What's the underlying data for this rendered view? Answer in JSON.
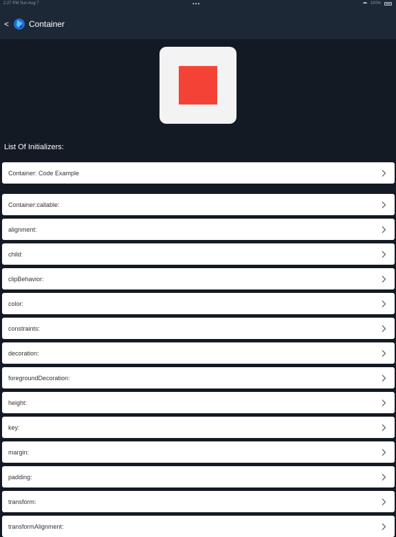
{
  "status_bar": {
    "time": "2:27 PM   Sun Aug 7",
    "dots": "•••",
    "battery": "100%"
  },
  "nav": {
    "back": "<",
    "title": "Container",
    "logo_icon": "flutter-logo-icon"
  },
  "preview": {
    "box_color": "#f3f3f3",
    "square_color": "#f44336"
  },
  "section_title": "List Of Initializers:",
  "code_example": "Container: Code Example",
  "items": [
    "Container:callable:",
    "alignment:",
    "child:",
    "clipBehavior:",
    "color:",
    "constraints:",
    "decoration:",
    "foregroundDecoration:",
    "height:",
    "key:",
    "margin:",
    "padding:",
    "transform:",
    "transformAlignment:"
  ]
}
